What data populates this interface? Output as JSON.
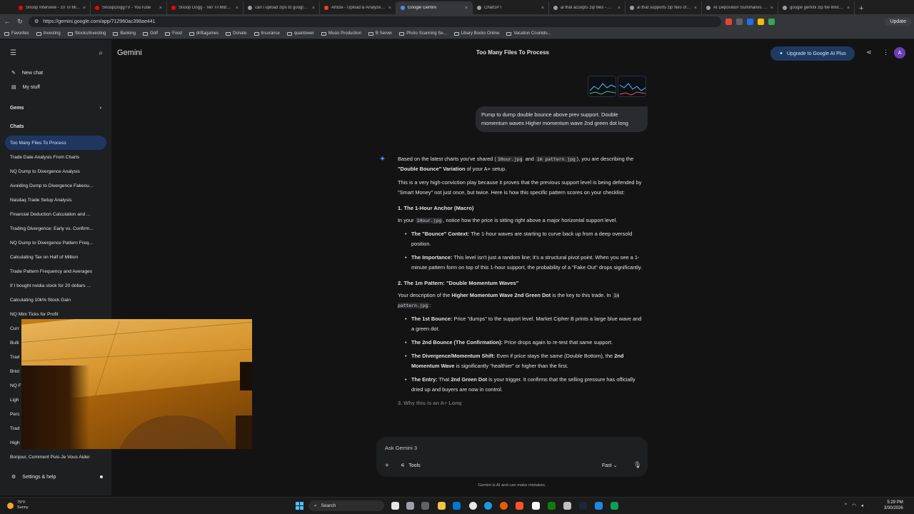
{
  "browser": {
    "tabs": [
      {
        "label": "Snoop Interview - 10 Til Mi...",
        "color": "#ff0000"
      },
      {
        "label": "SnoopDoggTV - YouTube",
        "color": "#ff0000"
      },
      {
        "label": "Snoop Dogg - Ten Til Midni...",
        "color": "#ff0000"
      },
      {
        "label": "can i upload zips to google...",
        "color": "#9aa0a6"
      },
      {
        "label": "Article - Upload & Analyze ...",
        "color": "#ff3b30"
      },
      {
        "label": "Google Gemini",
        "color": "#4e8cff",
        "active": true
      },
      {
        "label": "ChatGPT",
        "color": "#9aa0a6"
      },
      {
        "label": "ai that accepts zip files - Go...",
        "color": "#9aa0a6"
      },
      {
        "label": "ai that supports zip files of ...",
        "color": "#9aa0a6"
      },
      {
        "label": "AI Deposition Summaries &...",
        "color": "#9aa0a6"
      },
      {
        "label": "google gemini zip file limits...",
        "color": "#9aa0a6"
      }
    ],
    "url": "https://gemini.google.com/app/712960ac398ae441",
    "update_label": "Update",
    "bookmarks": [
      "Favorites",
      "Investing",
      "Stocks/Investing",
      "Banking",
      "Golf",
      "Food",
      "driftagames",
      "Donate",
      "Insurance",
      "quantower",
      "Music Production",
      "B Server",
      "Photo Scanning Se...",
      "Libary Books Online",
      "Vacation Countdo..."
    ]
  },
  "sidebar": {
    "new_chat": "New chat",
    "my_stuff": "My stuff",
    "gems": "Gems",
    "chats_header": "Chats",
    "chats": [
      "Too Many Files To Process",
      "Trade Date Analysis From Charts",
      "NQ Dump to Divergence Analysis",
      "Avoiding Dump to Divergence Fakeou...",
      "Nasdaq Trade Setup Analysis",
      "Financial Deduction Calculation and ...",
      "Trading Divergence: Early vs. Confirm...",
      "NQ Dump to Divergence Pattern Freq...",
      "Calculating Tax on Half of Million",
      "Trade Pattern Frequency and Averages",
      "If I bought nvidia stock for 20 dollars ...",
      "Calculating 10k% Stock Gain",
      "NQ Mini Ticks for Profit",
      "Curr",
      "Bulli",
      "Trad",
      "Brist",
      "NQ F",
      "Ligh",
      "Perc",
      "Trad",
      "High",
      "Bonjour, Comment Puis-Je Vous Aider"
    ],
    "settings": "Settings & help"
  },
  "header": {
    "brand": "Gemini",
    "title": "Too Many Files To Process",
    "upgrade": "Upgrade to Google AI Plus",
    "avatar": "A"
  },
  "conversation": {
    "user_message": "Pump to dump double bounce above prev support. Double momentum waves Higher momentum wave 2nd green dot long",
    "intro_1": "Based on the latest charts you've shared (",
    "file_1": "1Hour.jpg",
    "intro_and": " and ",
    "file_2": "1m pattern.jpg",
    "intro_2": "), you are describing the ",
    "intro_bold": "\"Double Bounce\" Variation",
    "intro_3": " of your A+ setup.",
    "para_2": "This is a very high-conviction play because it proves that the previous support level is being defended by \"Smart Money\" not just once, but twice. Here is how this specific pattern scores on your checklist:",
    "h1": "1. The 1-Hour Anchor (Macro)",
    "s1_a": "In your ",
    "s1_file": "1Hour.jpg",
    "s1_b": ", notice how the price is sitting right above a major horizontal support level.",
    "s1_bullets": [
      {
        "bold": "The \"Bounce\" Context:",
        "text": " The 1-hour waves are starting to curve back up from a deep oversold position."
      },
      {
        "bold": "The Importance:",
        "text": " This level isn't just a random line; it's a structural pivot point. When you see a 1-minute pattern form on top of this 1-hour support, the probability of a \"Fake Out\" drops significantly."
      }
    ],
    "h2": "2. The 1m Pattern: \"Double Momentum Waves\"",
    "s2_a": "Your description of the ",
    "s2_bold": "Higher Momentum Wave 2nd Green Dot",
    "s2_b": " is the key to this trade. In ",
    "s2_file": "1m pattern.jpg",
    "s2_c": ":",
    "s2_bullets": [
      {
        "bold": "The 1st Bounce:",
        "text": " Price \"dumps\" to the support level. Market Cipher B prints a large blue wave and a green dot."
      },
      {
        "bold": "The 2nd Bounce (The Confirmation):",
        "text": " Price drops again to re-test that same support."
      },
      {
        "bold": "The Divergence/Momentum Shift:",
        "text": " Even if price stays the same (Double Bottom), the "
      },
      {
        "bold": "The Entry:",
        "text": " That "
      }
    ],
    "s2_b3_bold2": "2nd Momentum Wave",
    "s2_b3_tail": " is significantly \"healthier\" or higher than the first.",
    "s2_b4_bold2": "2nd Green Dot",
    "s2_b4_tail": " is your trigger. It confirms that the selling pressure has officially dried up and buyers are now in control.",
    "faded": "3. Why this is an A+ Long"
  },
  "input": {
    "placeholder": "Ask Gemini 3",
    "tools": "Tools",
    "mode": "Fast",
    "disclaimer": "Gemini is AI and can make mistakes."
  },
  "taskbar": {
    "temp": "79°F",
    "weather": "Sunny",
    "search": "Search",
    "time": "5:29 PM",
    "date": "3/30/2026"
  }
}
